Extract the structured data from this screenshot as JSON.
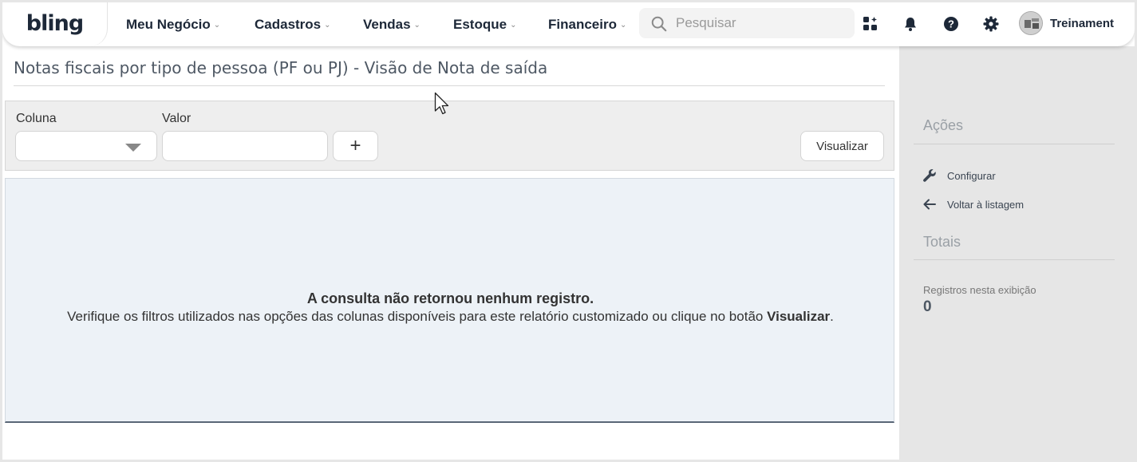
{
  "app": {
    "logo": "bling"
  },
  "nav": {
    "items": [
      {
        "label": "Meu Negócio"
      },
      {
        "label": "Cadastros"
      },
      {
        "label": "Vendas"
      },
      {
        "label": "Estoque"
      },
      {
        "label": "Financeiro"
      }
    ]
  },
  "search": {
    "placeholder": "Pesquisar"
  },
  "header_icons": [
    "apps-icon",
    "bell-icon",
    "help-icon",
    "gear-icon"
  ],
  "user": {
    "name": "Treinament"
  },
  "page": {
    "title": "Notas fiscais por tipo de pessoa (PF ou PJ) - Visão de Nota de saída"
  },
  "filters": {
    "column_label": "Coluna",
    "value_label": "Valor",
    "add_label": "+",
    "visualize_label": "Visualizar"
  },
  "empty_state": {
    "title": "A consulta não retornou nenhum registro.",
    "message_prefix": "Verifique os filtros utilizados nas opções das colunas disponíveis para este relatório customizado ou clique no botão ",
    "message_bold": "Visualizar",
    "message_suffix": "."
  },
  "sidebar": {
    "actions_heading": "Ações",
    "actions": [
      {
        "label": "Configurar",
        "icon": "wrench-icon"
      },
      {
        "label": "Voltar à listagem",
        "icon": "arrow-left-icon"
      }
    ],
    "totals_heading": "Totais",
    "records_label": "Registros nesta exibição",
    "records_value": "0"
  },
  "colors": {
    "nav_text": "#1d2838",
    "result_bg": "#edf2f7",
    "sidebar_bg": "#e6e6e6"
  }
}
